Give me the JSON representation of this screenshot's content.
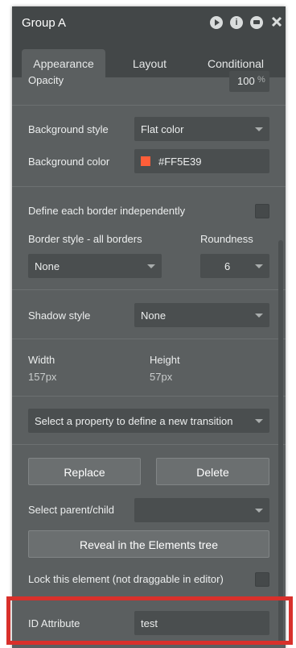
{
  "window": {
    "title": "Group A"
  },
  "tabs": [
    {
      "label": "Appearance"
    },
    {
      "label": "Layout"
    },
    {
      "label": "Conditional"
    }
  ],
  "opacity": {
    "label": "Opacity",
    "value": "100",
    "unit": "%"
  },
  "background": {
    "style_label": "Background style",
    "style_value": "Flat color",
    "color_label": "Background color",
    "color_value": "#FF5E39",
    "swatch_color": "#FF5E39"
  },
  "border": {
    "independent_label": "Define each border independently",
    "style_label": "Border style - all borders",
    "style_value": "None",
    "roundness_label": "Roundness",
    "roundness_value": "6"
  },
  "shadow": {
    "label": "Shadow style",
    "value": "None"
  },
  "size": {
    "width_label": "Width",
    "width_value": "157px",
    "height_label": "Height",
    "height_value": "57px"
  },
  "transition": {
    "placeholder": "Select a property to define a new transition"
  },
  "actions": {
    "replace_label": "Replace",
    "delete_label": "Delete"
  },
  "parent_child": {
    "label": "Select parent/child",
    "value": ""
  },
  "reveal": {
    "label": "Reveal in the Elements tree"
  },
  "lock": {
    "label": "Lock this element (not draggable in editor)"
  },
  "id_attribute": {
    "label": "ID Attribute",
    "value": "test"
  },
  "colors": {
    "highlight": "#d8302b",
    "panel": "#5b5f60",
    "titlebar": "#434748"
  }
}
